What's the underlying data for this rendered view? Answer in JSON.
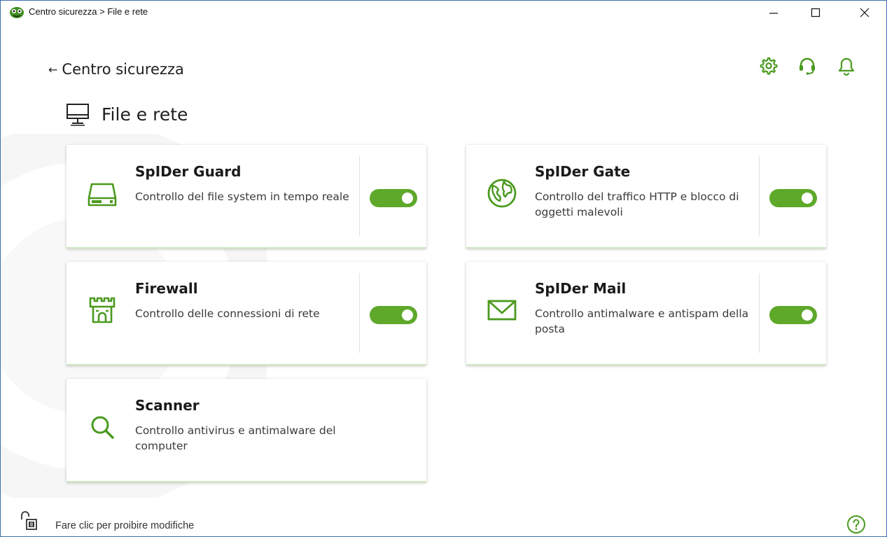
{
  "window": {
    "title": "Centro sicurezza > File e rete",
    "controls": [
      "minimize-icon",
      "maximize-icon",
      "close-icon"
    ]
  },
  "header": {
    "back_label": "Centro sicurezza",
    "icons": [
      "settings-icon",
      "support-icon",
      "notifications-icon"
    ]
  },
  "page": {
    "title": "File e rete",
    "icon": "monitor-icon"
  },
  "components": [
    {
      "title": "SpIDer Guard",
      "description": "Controllo del file system in tempo reale",
      "icon": "hard-drive-icon",
      "enabled": true
    },
    {
      "title": "SpIDer Gate",
      "description": "Controllo del traffico HTTP e blocco di oggetti malevoli",
      "icon": "globe-icon",
      "enabled": true
    },
    {
      "title": "Firewall",
      "description": "Controllo delle connessioni di rete",
      "icon": "castle-icon",
      "enabled": true
    },
    {
      "title": "SpIDer Mail",
      "description": "Controllo antimalware e antispam della posta",
      "icon": "mail-icon",
      "enabled": true
    },
    {
      "title": "Scanner",
      "description": "Controllo antivirus e antimalware del computer",
      "icon": "search-icon"
    }
  ],
  "footer": {
    "lock_text": "Fare clic per proibire modifiche",
    "help_icon": "help-icon"
  },
  "colors": {
    "accent": "#5ea82a",
    "text": "#1f1f1f",
    "window_border": "#3c6fb0"
  }
}
